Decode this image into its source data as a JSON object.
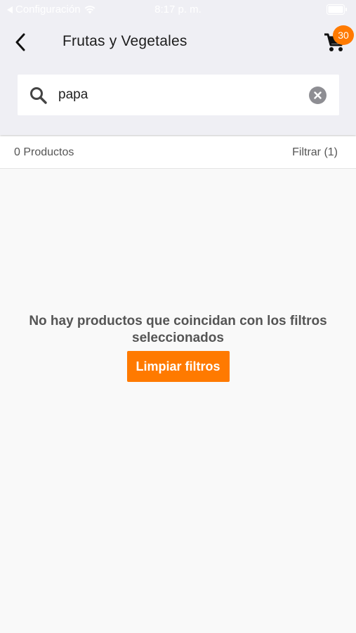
{
  "status_bar": {
    "back_app": "Configuración",
    "time": "8:17 p. m."
  },
  "header": {
    "title": "Frutas y Vegetales",
    "cart_count": "30"
  },
  "search": {
    "value": "papa",
    "placeholder": ""
  },
  "results": {
    "count_label": "0 Productos",
    "filter_label": "Filtrar (1)"
  },
  "empty_state": {
    "message": "No hay productos que coincidan con los filtros seleccionados",
    "clear_button": "Limpiar filtros"
  },
  "colors": {
    "accent": "#ff7a00",
    "header_bg": "#efeff4",
    "background": "#f9f9f9"
  }
}
